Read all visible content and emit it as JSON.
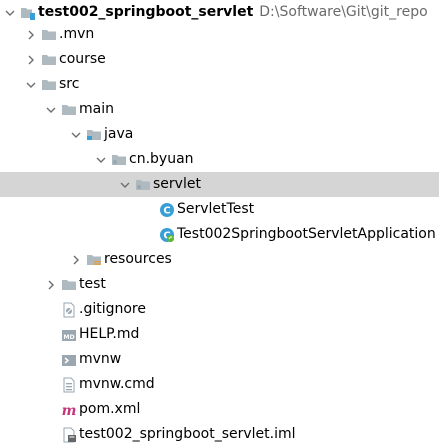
{
  "project": {
    "name": "test002_springboot_servlet",
    "path": "D:\\Software\\Git\\git_repo"
  },
  "tree": [
    {
      "label": ".mvn",
      "chevron": "right",
      "icon": "folder-icon"
    },
    {
      "label": "course",
      "chevron": "right",
      "icon": "folder-icon"
    },
    {
      "label": "src",
      "chevron": "down",
      "icon": "folder-icon"
    },
    {
      "label": "main",
      "chevron": "down",
      "icon": "folder-icon"
    },
    {
      "label": "java",
      "chevron": "down",
      "icon": "source-folder-icon"
    },
    {
      "label": "cn.byuan",
      "chevron": "down",
      "icon": "package-icon"
    },
    {
      "label": "servlet",
      "chevron": "down",
      "icon": "package-icon",
      "selected": true
    },
    {
      "label": "ServletTest",
      "icon": "java-class-icon"
    },
    {
      "label": "Test002SpringbootServletApplication",
      "icon": "spring-boot-class-icon"
    },
    {
      "label": "resources",
      "chevron": "right",
      "icon": "resources-folder-icon"
    },
    {
      "label": "test",
      "chevron": "right",
      "icon": "folder-icon"
    },
    {
      "label": ".gitignore",
      "icon": "gitignore-file-icon"
    },
    {
      "label": "HELP.md",
      "icon": "markdown-file-icon"
    },
    {
      "label": "mvnw",
      "icon": "script-file-icon"
    },
    {
      "label": "mvnw.cmd",
      "icon": "text-file-icon"
    },
    {
      "label": "pom.xml",
      "icon": "maven-file-icon"
    },
    {
      "label": "test002_springboot_servlet.iml",
      "icon": "iml-file-icon"
    }
  ],
  "colors": {
    "selection": "#d5d5d5",
    "folder": "#aeb9c0",
    "chevron": "#6e6e6e",
    "class_blue": "#389fd6",
    "spring_green": "#5fb832",
    "maven_pink": "#c4357b",
    "path_gray": "#6a6a6a"
  }
}
